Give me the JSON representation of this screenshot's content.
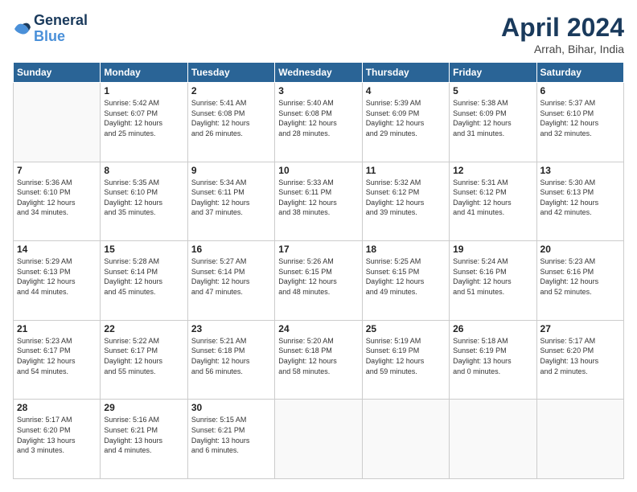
{
  "header": {
    "logo_line1": "General",
    "logo_line2": "Blue",
    "title": "April 2024",
    "location": "Arrah, Bihar, India"
  },
  "days_of_week": [
    "Sunday",
    "Monday",
    "Tuesday",
    "Wednesday",
    "Thursday",
    "Friday",
    "Saturday"
  ],
  "weeks": [
    [
      {
        "day": "",
        "info": ""
      },
      {
        "day": "1",
        "info": "Sunrise: 5:42 AM\nSunset: 6:07 PM\nDaylight: 12 hours\nand 25 minutes."
      },
      {
        "day": "2",
        "info": "Sunrise: 5:41 AM\nSunset: 6:08 PM\nDaylight: 12 hours\nand 26 minutes."
      },
      {
        "day": "3",
        "info": "Sunrise: 5:40 AM\nSunset: 6:08 PM\nDaylight: 12 hours\nand 28 minutes."
      },
      {
        "day": "4",
        "info": "Sunrise: 5:39 AM\nSunset: 6:09 PM\nDaylight: 12 hours\nand 29 minutes."
      },
      {
        "day": "5",
        "info": "Sunrise: 5:38 AM\nSunset: 6:09 PM\nDaylight: 12 hours\nand 31 minutes."
      },
      {
        "day": "6",
        "info": "Sunrise: 5:37 AM\nSunset: 6:10 PM\nDaylight: 12 hours\nand 32 minutes."
      }
    ],
    [
      {
        "day": "7",
        "info": "Sunrise: 5:36 AM\nSunset: 6:10 PM\nDaylight: 12 hours\nand 34 minutes."
      },
      {
        "day": "8",
        "info": "Sunrise: 5:35 AM\nSunset: 6:10 PM\nDaylight: 12 hours\nand 35 minutes."
      },
      {
        "day": "9",
        "info": "Sunrise: 5:34 AM\nSunset: 6:11 PM\nDaylight: 12 hours\nand 37 minutes."
      },
      {
        "day": "10",
        "info": "Sunrise: 5:33 AM\nSunset: 6:11 PM\nDaylight: 12 hours\nand 38 minutes."
      },
      {
        "day": "11",
        "info": "Sunrise: 5:32 AM\nSunset: 6:12 PM\nDaylight: 12 hours\nand 39 minutes."
      },
      {
        "day": "12",
        "info": "Sunrise: 5:31 AM\nSunset: 6:12 PM\nDaylight: 12 hours\nand 41 minutes."
      },
      {
        "day": "13",
        "info": "Sunrise: 5:30 AM\nSunset: 6:13 PM\nDaylight: 12 hours\nand 42 minutes."
      }
    ],
    [
      {
        "day": "14",
        "info": "Sunrise: 5:29 AM\nSunset: 6:13 PM\nDaylight: 12 hours\nand 44 minutes."
      },
      {
        "day": "15",
        "info": "Sunrise: 5:28 AM\nSunset: 6:14 PM\nDaylight: 12 hours\nand 45 minutes."
      },
      {
        "day": "16",
        "info": "Sunrise: 5:27 AM\nSunset: 6:14 PM\nDaylight: 12 hours\nand 47 minutes."
      },
      {
        "day": "17",
        "info": "Sunrise: 5:26 AM\nSunset: 6:15 PM\nDaylight: 12 hours\nand 48 minutes."
      },
      {
        "day": "18",
        "info": "Sunrise: 5:25 AM\nSunset: 6:15 PM\nDaylight: 12 hours\nand 49 minutes."
      },
      {
        "day": "19",
        "info": "Sunrise: 5:24 AM\nSunset: 6:16 PM\nDaylight: 12 hours\nand 51 minutes."
      },
      {
        "day": "20",
        "info": "Sunrise: 5:23 AM\nSunset: 6:16 PM\nDaylight: 12 hours\nand 52 minutes."
      }
    ],
    [
      {
        "day": "21",
        "info": "Sunrise: 5:23 AM\nSunset: 6:17 PM\nDaylight: 12 hours\nand 54 minutes."
      },
      {
        "day": "22",
        "info": "Sunrise: 5:22 AM\nSunset: 6:17 PM\nDaylight: 12 hours\nand 55 minutes."
      },
      {
        "day": "23",
        "info": "Sunrise: 5:21 AM\nSunset: 6:18 PM\nDaylight: 12 hours\nand 56 minutes."
      },
      {
        "day": "24",
        "info": "Sunrise: 5:20 AM\nSunset: 6:18 PM\nDaylight: 12 hours\nand 58 minutes."
      },
      {
        "day": "25",
        "info": "Sunrise: 5:19 AM\nSunset: 6:19 PM\nDaylight: 12 hours\nand 59 minutes."
      },
      {
        "day": "26",
        "info": "Sunrise: 5:18 AM\nSunset: 6:19 PM\nDaylight: 13 hours\nand 0 minutes."
      },
      {
        "day": "27",
        "info": "Sunrise: 5:17 AM\nSunset: 6:20 PM\nDaylight: 13 hours\nand 2 minutes."
      }
    ],
    [
      {
        "day": "28",
        "info": "Sunrise: 5:17 AM\nSunset: 6:20 PM\nDaylight: 13 hours\nand 3 minutes."
      },
      {
        "day": "29",
        "info": "Sunrise: 5:16 AM\nSunset: 6:21 PM\nDaylight: 13 hours\nand 4 minutes."
      },
      {
        "day": "30",
        "info": "Sunrise: 5:15 AM\nSunset: 6:21 PM\nDaylight: 13 hours\nand 6 minutes."
      },
      {
        "day": "",
        "info": ""
      },
      {
        "day": "",
        "info": ""
      },
      {
        "day": "",
        "info": ""
      },
      {
        "day": "",
        "info": ""
      }
    ]
  ]
}
